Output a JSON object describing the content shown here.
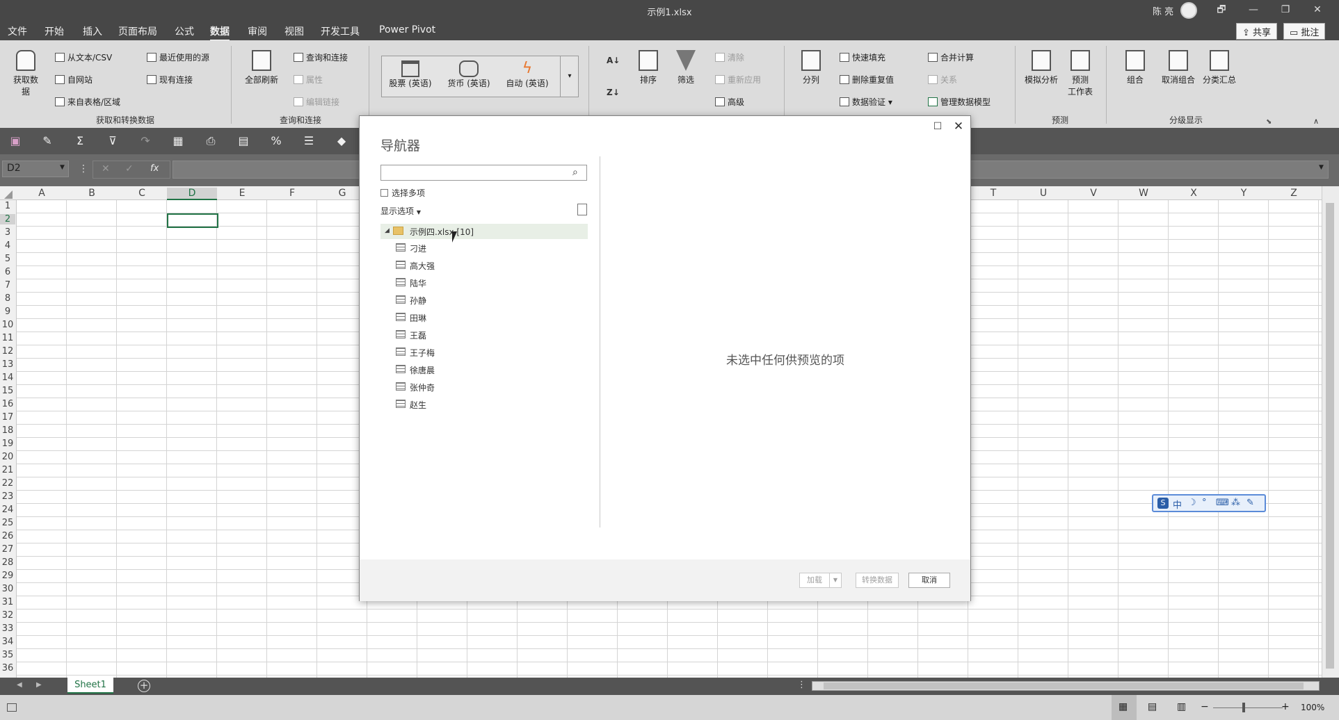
{
  "window": {
    "title": "示例1.xlsx",
    "user": "陈 亮",
    "controls": [
      "🗗",
      "—",
      "❐",
      "✕"
    ]
  },
  "menu": {
    "tabs": [
      "文件",
      "开始",
      "插入",
      "页面布局",
      "公式",
      "数据",
      "审阅",
      "视图",
      "开发工具",
      "Power Pivot"
    ],
    "active": "数据",
    "share_label": "共享",
    "comments_label": "批注"
  },
  "ribbon": {
    "get_data": "获取数据",
    "from_text": "从文本/CSV",
    "from_web": "自网站",
    "from_table": "来自表格/区域",
    "recent_sources": "最近使用的源",
    "existing_connections": "现有连接",
    "group_get_transform": "获取和转换数据",
    "refresh_all": "全部刷新",
    "queries_connections": "查询和连接",
    "properties": "属性",
    "edit_links": "编辑链接",
    "group_queries": "查询和连接",
    "stocks": "股票 (英语)",
    "currency": "货币 (英语)",
    "auto": "自动 (英语)",
    "sort": "排序",
    "filter": "筛选",
    "clear": "清除",
    "reapply": "重新应用",
    "advanced": "高级",
    "text_to_columns": "分列",
    "flash_fill": "快速填充",
    "remove_duplicates": "删除重复值",
    "data_validation": "数据验证",
    "consolidate": "合并计算",
    "relationships": "关系",
    "manage_data_model": "管理数据模型",
    "what_if": "模拟分析",
    "forecast_sheet_1": "预测",
    "forecast_sheet_2": "工作表",
    "group_forecast": "预测",
    "group": "组合",
    "ungroup": "取消组合",
    "subtotal": "分类汇总",
    "group_outline": "分级显示"
  },
  "formula_bar": {
    "name_box": "D2",
    "fx": "fx"
  },
  "grid": {
    "columns_left": [
      "A",
      "B",
      "C",
      "D",
      "E",
      "F",
      "G"
    ],
    "columns_right": [
      "T",
      "U",
      "V",
      "W",
      "X",
      "Y",
      "Z"
    ],
    "rows": [
      "1",
      "2",
      "3",
      "4",
      "5",
      "6",
      "7",
      "8",
      "9",
      "10",
      "11",
      "12",
      "13",
      "14",
      "15",
      "16",
      "17",
      "18",
      "19",
      "20",
      "21",
      "22",
      "23",
      "24",
      "25",
      "26",
      "27",
      "28",
      "29",
      "30",
      "31",
      "32",
      "33",
      "34",
      "35",
      "36"
    ],
    "selected_cell": "D2"
  },
  "sheets": {
    "active": "Sheet1"
  },
  "status": {
    "zoom": "100%"
  },
  "ime": {
    "items": [
      "中",
      "☽",
      "°",
      "⌨",
      "⁂",
      "✎"
    ]
  },
  "navigator": {
    "title": "导航器",
    "select_multiple": "选择多项",
    "display_options": "显示选项",
    "root_label": "示例四.xlsx [10]",
    "items": [
      "刁进",
      "高大强",
      "陆华",
      "孙静",
      "田琳",
      "王磊",
      "王子梅",
      "徐唐晨",
      "张仲奇",
      "赵生"
    ],
    "empty_message": "未选中任何供预览的项",
    "load_button": "加载",
    "transform_button": "转换数据",
    "cancel_button": "取消"
  }
}
